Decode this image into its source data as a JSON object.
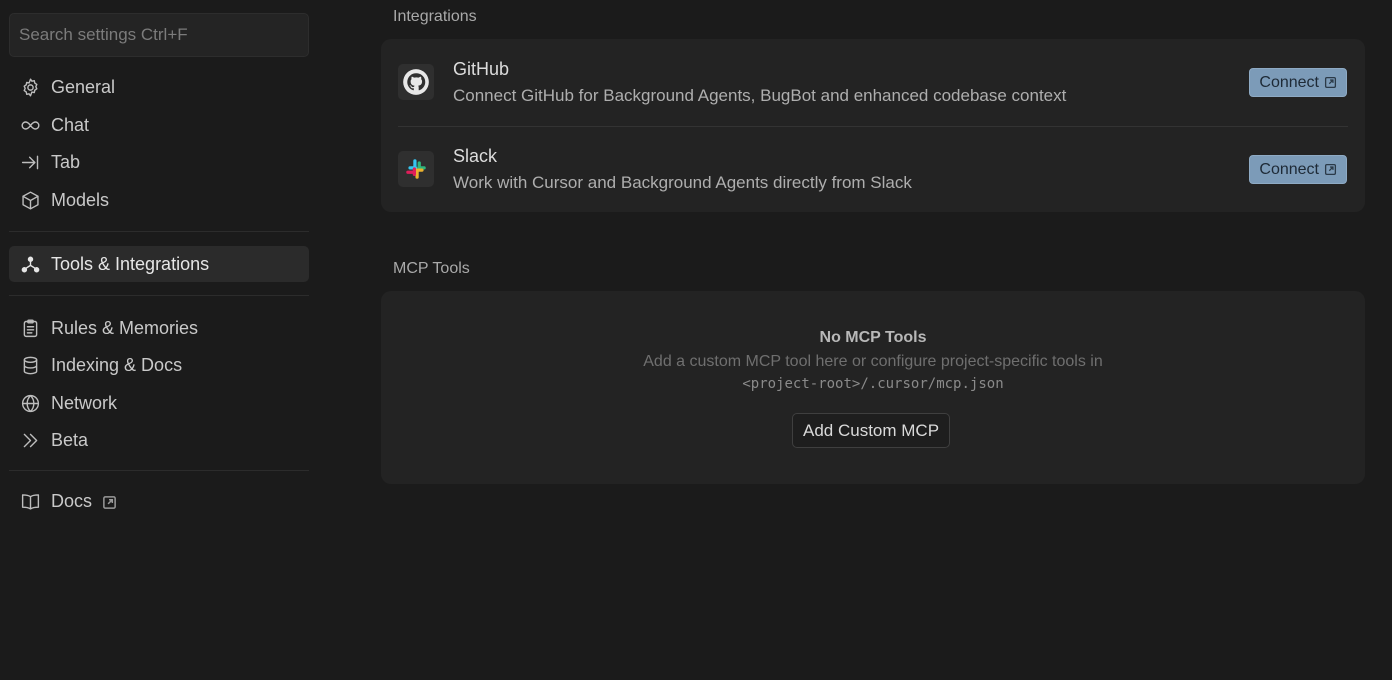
{
  "sidebar": {
    "search_placeholder": "Search settings Ctrl+F",
    "items": [
      {
        "label": "General",
        "icon": "gear-icon"
      },
      {
        "label": "Chat",
        "icon": "infinity-icon"
      },
      {
        "label": "Tab",
        "icon": "arrow-right-bar-icon"
      },
      {
        "label": "Models",
        "icon": "cube-icon"
      },
      {
        "label": "Tools & Integrations",
        "icon": "nodes-icon",
        "active": true
      },
      {
        "label": "Rules & Memories",
        "icon": "clipboard-icon"
      },
      {
        "label": "Indexing & Docs",
        "icon": "database-icon"
      },
      {
        "label": "Network",
        "icon": "globe-icon"
      },
      {
        "label": "Beta",
        "icon": "double-chevron-icon"
      },
      {
        "label": "Docs",
        "icon": "book-icon",
        "external": true
      }
    ]
  },
  "integrations": {
    "title": "Integrations",
    "items": [
      {
        "name": "GitHub",
        "description": "Connect GitHub for Background Agents, BugBot and enhanced codebase context",
        "button": "Connect",
        "icon": "github-icon"
      },
      {
        "name": "Slack",
        "description": "Work with Cursor and Background Agents directly from Slack",
        "button": "Connect",
        "icon": "slack-icon"
      }
    ]
  },
  "mcp": {
    "title": "MCP Tools",
    "empty_title": "No MCP Tools",
    "empty_desc": "Add a custom MCP tool here or configure project-specific tools in",
    "empty_path": "<project-root>/.cursor/mcp.json",
    "add_button": "Add Custom MCP"
  },
  "colors": {
    "background": "#1b1b1b",
    "card": "#232323",
    "accent_button": "#7c9bb8"
  }
}
